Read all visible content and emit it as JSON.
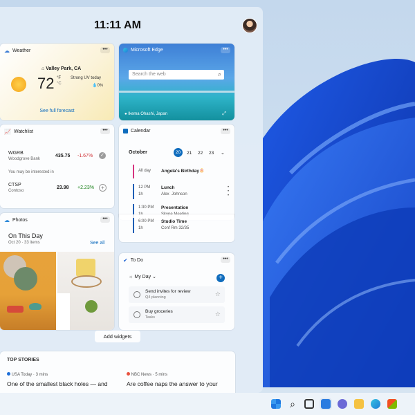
{
  "clock": "11:11 AM",
  "weather": {
    "title": "Weather",
    "location": "Valley Park, CA",
    "temp": "72",
    "unit_f": "°F",
    "unit_c": "°C",
    "uv": "Strong UV today",
    "precip": "0%",
    "link": "See full forecast"
  },
  "edge": {
    "title": "Microsoft Edge",
    "search_placeholder": "Search the web",
    "caption": "Ikema Ohashi, Japan"
  },
  "watchlist": {
    "title": "Watchlist",
    "stock1": {
      "ticker": "WGRB",
      "name": "Woodgrove Bank",
      "price": "435.75",
      "change": "-1.67%"
    },
    "suggest": "You may be interested in",
    "stock2": {
      "ticker": "CTSP",
      "name": "Contoso",
      "price": "23.98",
      "change": "+2.23%"
    }
  },
  "calendar": {
    "title": "Calendar",
    "month": "October",
    "days": [
      "20",
      "21",
      "22",
      "23"
    ],
    "events": [
      {
        "time": "All day",
        "duration": "",
        "title": "Angela's Birthday",
        "sub": "",
        "color": "#d6337f"
      },
      {
        "time": "12 PM",
        "duration": "1h",
        "title": "Lunch",
        "sub": "Alex  Johnson",
        "color": "#1f5fb5"
      },
      {
        "time": "1:30 PM",
        "duration": "1h",
        "title": "Presentation",
        "sub": "Skype Meeting",
        "color": "#1f5fb5"
      },
      {
        "time": "6:00 PM",
        "duration": "1h",
        "title": "Studio Time",
        "sub": "Conf Rm 32/35",
        "color": "#1f5fb5"
      }
    ]
  },
  "photos": {
    "title": "Photos",
    "heading": "On This Day",
    "sub": "Oct 20 · 33 items",
    "see_all": "See all"
  },
  "todo": {
    "title": "To Do",
    "list": "My Day",
    "tasks": [
      {
        "title": "Send invites for review",
        "sub": "Q4 planning"
      },
      {
        "title": "Buy groceries",
        "sub": "Tasks"
      }
    ]
  },
  "add_widgets": "Add widgets",
  "stories": {
    "header": "TOP STORIES",
    "items": [
      {
        "source": "USA Today · 3 mins",
        "headline": "One of the smallest black holes — and"
      },
      {
        "source": "NBC News · 5 mins",
        "headline": "Are coffee naps the answer to your"
      }
    ]
  },
  "colors": {
    "accent": "#0f6cbd",
    "negative": "#d13438",
    "positive": "#107c10"
  }
}
